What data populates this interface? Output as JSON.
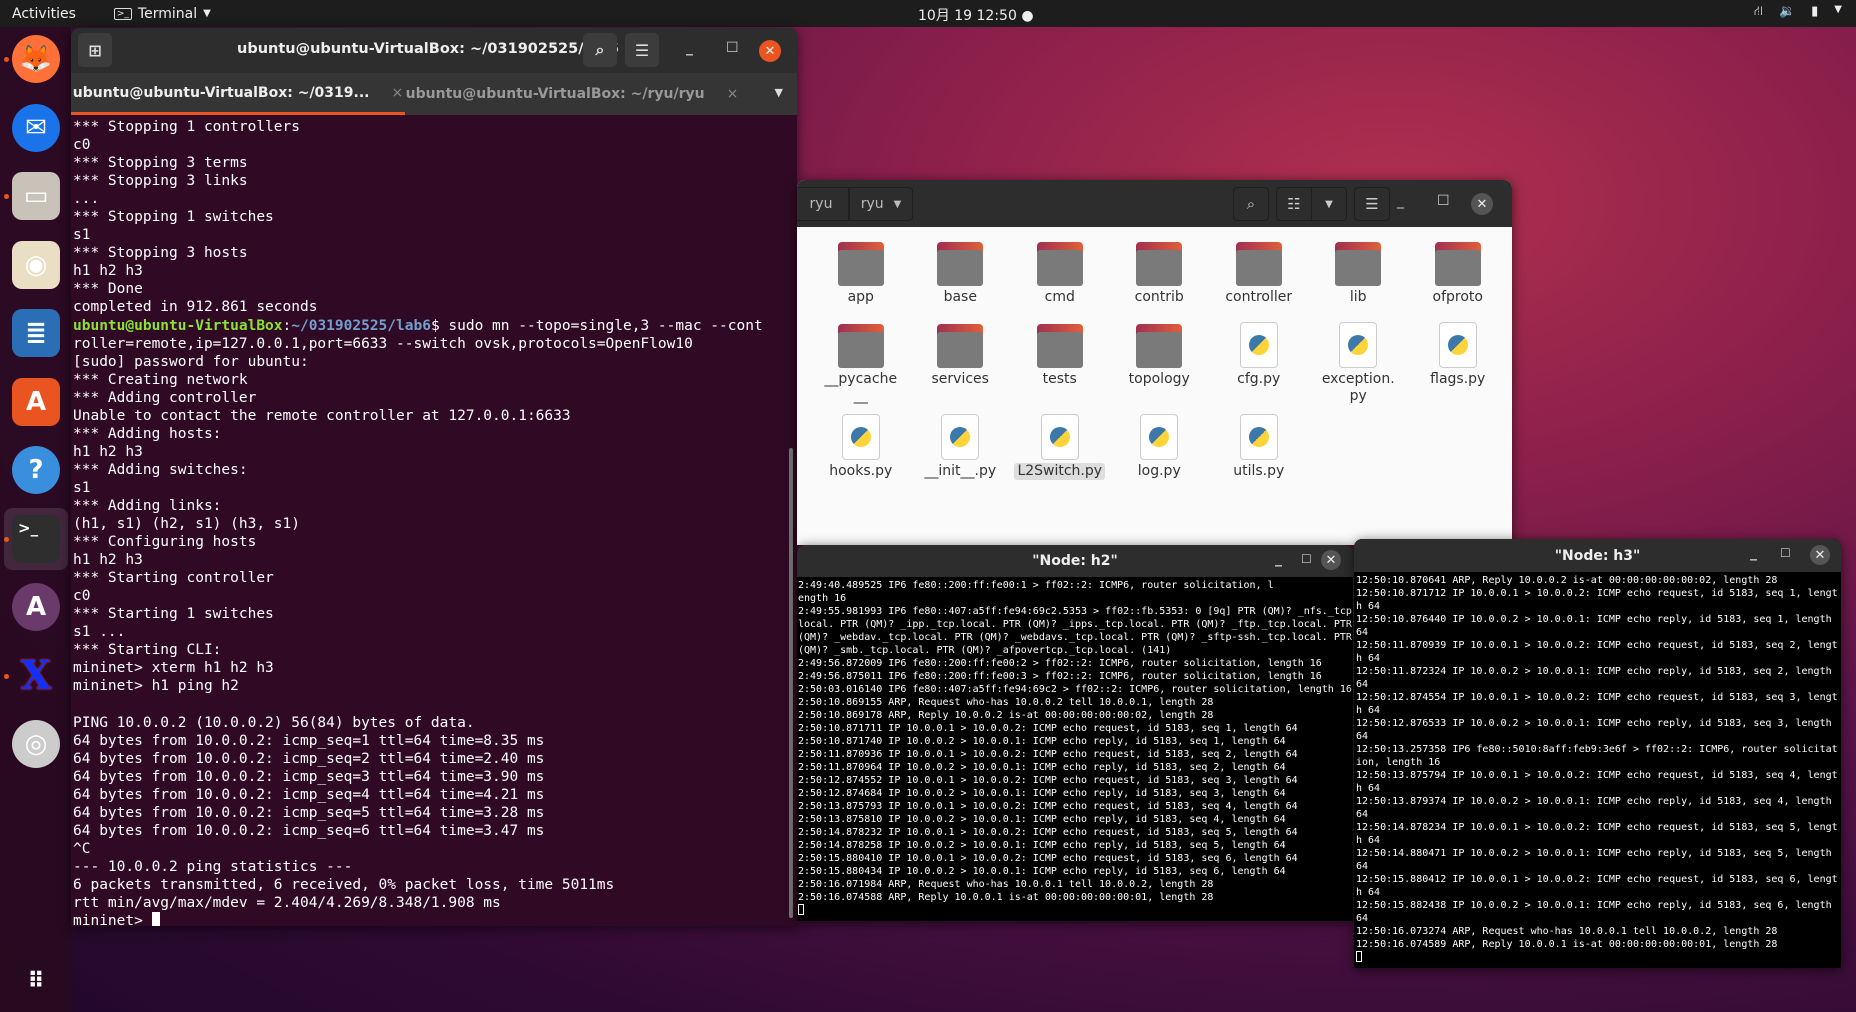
{
  "topbar": {
    "activities": "Activities",
    "app_name": "Terminal",
    "clock": "10月 19  12:50"
  },
  "dock": {
    "items": [
      {
        "name": "firefox",
        "icon": "firefox-icon",
        "running": true
      },
      {
        "name": "thunderbird",
        "icon": "thunderbird-icon",
        "running": false
      },
      {
        "name": "files",
        "icon": "files-icon",
        "running": true
      },
      {
        "name": "rhythmbox",
        "icon": "rhythmbox-icon",
        "running": false
      },
      {
        "name": "libreoffice-writer",
        "icon": "writer-icon",
        "running": false
      },
      {
        "name": "software",
        "icon": "software-icon",
        "running": false
      },
      {
        "name": "help",
        "icon": "help-icon",
        "running": false
      },
      {
        "name": "terminal",
        "icon": "terminal-icon",
        "running": true
      },
      {
        "name": "software-updater",
        "icon": "updater-icon",
        "running": false
      },
      {
        "name": "xterm",
        "icon": "xterm-icon",
        "running": true
      },
      {
        "name": "dvd",
        "icon": "disc-icon",
        "running": false
      }
    ]
  },
  "terminal": {
    "title": "ubuntu@ubuntu-VirtualBox: ~/031902525/lab6",
    "tabs": [
      {
        "label": "ubuntu@ubuntu-VirtualBox: ~/0319...",
        "active": true
      },
      {
        "label": "ubuntu@ubuntu-VirtualBox: ~/ryu/ryu",
        "active": false
      }
    ],
    "tab_close": "×",
    "lines_before": [
      "*** Stopping 1 controllers",
      "c0",
      "*** Stopping 3 terms",
      "*** Stopping 3 links",
      "...",
      "*** Stopping 1 switches",
      "s1",
      "*** Stopping 3 hosts",
      "h1 h2 h3",
      "*** Done",
      "completed in 912.861 seconds"
    ],
    "prompt": {
      "user_host": "ubuntu@ubuntu-VirtualBox",
      "path": "~/031902525/lab6",
      "command": "$ sudo mn --topo=single,3 --mac --cont"
    },
    "lines_after": [
      "roller=remote,ip=127.0.0.1,port=6633 --switch ovsk,protocols=OpenFlow10",
      "[sudo] password for ubuntu:",
      "*** Creating network",
      "*** Adding controller",
      "Unable to contact the remote controller at 127.0.0.1:6633",
      "*** Adding hosts:",
      "h1 h2 h3",
      "*** Adding switches:",
      "s1",
      "*** Adding links:",
      "(h1, s1) (h2, s1) (h3, s1)",
      "*** Configuring hosts",
      "h1 h2 h3",
      "*** Starting controller",
      "c0",
      "*** Starting 1 switches",
      "s1 ...",
      "*** Starting CLI:",
      "mininet> xterm h1 h2 h3",
      "mininet> h1 ping h2",
      "",
      "PING 10.0.0.2 (10.0.0.2) 56(84) bytes of data.",
      "64 bytes from 10.0.0.2: icmp_seq=1 ttl=64 time=8.35 ms",
      "64 bytes from 10.0.0.2: icmp_seq=2 ttl=64 time=2.40 ms",
      "64 bytes from 10.0.0.2: icmp_seq=3 ttl=64 time=3.90 ms",
      "64 bytes from 10.0.0.2: icmp_seq=4 ttl=64 time=4.21 ms",
      "64 bytes from 10.0.0.2: icmp_seq=5 ttl=64 time=3.28 ms",
      "64 bytes from 10.0.0.2: icmp_seq=6 ttl=64 time=3.47 ms",
      "^C",
      "--- 10.0.0.2 ping statistics ---",
      "6 packets transmitted, 6 received, 0% packet loss, time 5011ms",
      "rtt min/avg/max/mdev = 2.404/4.269/8.348/1.908 ms"
    ],
    "final_prompt": "mininet> "
  },
  "file_manager": {
    "breadcrumbs": [
      "ryu",
      "ryu"
    ],
    "files": [
      {
        "name": "app",
        "type": "folder"
      },
      {
        "name": "base",
        "type": "folder"
      },
      {
        "name": "cmd",
        "type": "folder"
      },
      {
        "name": "contrib",
        "type": "folder"
      },
      {
        "name": "controller",
        "type": "folder"
      },
      {
        "name": "lib",
        "type": "folder"
      },
      {
        "name": "ofproto",
        "type": "folder"
      },
      {
        "name": "__pycache__",
        "type": "folder"
      },
      {
        "name": "services",
        "type": "folder"
      },
      {
        "name": "tests",
        "type": "folder"
      },
      {
        "name": "topology",
        "type": "folder"
      },
      {
        "name": "cfg.py",
        "type": "python"
      },
      {
        "name": "exception.py",
        "type": "python"
      },
      {
        "name": "flags.py",
        "type": "python"
      },
      {
        "name": "hooks.py",
        "type": "python"
      },
      {
        "name": "__init__.py",
        "type": "python"
      },
      {
        "name": "L2Switch.py",
        "type": "python",
        "selected": true
      },
      {
        "name": "log.py",
        "type": "python"
      },
      {
        "name": "utils.py",
        "type": "python"
      }
    ]
  },
  "xterm_h2": {
    "title": "\"Node: h2\"",
    "lines": [
      "2:49:40.489525 IP6 fe80::200:ff:fe00:1 > ff02::2: ICMP6, router solicitation, l",
      "ength 16",
      "2:49:55.981993 IP6 fe80::407:a5ff:fe94:69c2.5353 > ff02::fb.5353: 0 [9q] PTR (QM)? _nfs._tcp",
      "local. PTR (QM)? _ipp._tcp.local. PTR (QM)? _ipps._tcp.local. PTR (QM)? _ftp._tcp.local. PTR",
      "(QM)? _webdav._tcp.local. PTR (QM)? _webdavs._tcp.local. PTR (QM)? _sftp-ssh._tcp.local. PTR",
      "(QM)? _smb._tcp.local. PTR (QM)? _afpovertcp._tcp.local. (141)",
      "2:49:56.872009 IP6 fe80::200:ff:fe00:2 > ff02::2: ICMP6, router solicitation, length 16",
      "2:49:56.875011 IP6 fe80::200:ff:fe00:3 > ff02::2: ICMP6, router solicitation, length 16",
      "2:50:03.016140 IP6 fe80::407:a5ff:fe94:69c2 > ff02::2: ICMP6, router solicitation, length 16",
      "2:50:10.869155 ARP, Request who-has 10.0.0.2 tell 10.0.0.1, length 28",
      "2:50:10.869178 ARP, Reply 10.0.0.2 is-at 00:00:00:00:00:02, length 28",
      "2:50:10.871711 IP 10.0.0.1 > 10.0.0.2: ICMP echo request, id 5183, seq 1, length 64",
      "2:50:10.871740 IP 10.0.0.2 > 10.0.0.1: ICMP echo reply, id 5183, seq 1, length 64",
      "2:50:11.870936 IP 10.0.0.1 > 10.0.0.2: ICMP echo request, id 5183, seq 2, length 64",
      "2:50:11.870964 IP 10.0.0.2 > 10.0.0.1: ICMP echo reply, id 5183, seq 2, length 64",
      "2:50:12.874552 IP 10.0.0.1 > 10.0.0.2: ICMP echo request, id 5183, seq 3, length 64",
      "2:50:12.874684 IP 10.0.0.2 > 10.0.0.1: ICMP echo reply, id 5183, seq 3, length 64",
      "2:50:13.875793 IP 10.0.0.1 > 10.0.0.2: ICMP echo request, id 5183, seq 4, length 64",
      "2:50:13.875810 IP 10.0.0.2 > 10.0.0.1: ICMP echo reply, id 5183, seq 4, length 64",
      "2:50:14.878232 IP 10.0.0.1 > 10.0.0.2: ICMP echo request, id 5183, seq 5, length 64",
      "2:50:14.878258 IP 10.0.0.2 > 10.0.0.1: ICMP echo reply, id 5183, seq 5, length 64",
      "2:50:15.880410 IP 10.0.0.1 > 10.0.0.2: ICMP echo request, id 5183, seq 6, length 64",
      "2:50:15.880434 IP 10.0.0.2 > 10.0.0.1: ICMP echo reply, id 5183, seq 6, length 64",
      "2:50:16.071984 ARP, Request who-has 10.0.0.1 tell 10.0.0.2, length 28",
      "2:50:16.074588 ARP, Reply 10.0.0.1 is-at 00:00:00:00:00:01, length 28"
    ]
  },
  "xterm_h3": {
    "title": "\"Node: h3\"",
    "lines": [
      "12:50:10.870641 ARP, Reply 10.0.0.2 is-at 00:00:00:00:00:02, length 28",
      "12:50:10.871712 IP 10.0.0.1 > 10.0.0.2: ICMP echo request, id 5183, seq 1, lengt",
      "h 64",
      "12:50:10.876440 IP 10.0.0.2 > 10.0.0.1: ICMP echo reply, id 5183, seq 1, length",
      "64",
      "12:50:11.870939 IP 10.0.0.1 > 10.0.0.2: ICMP echo request, id 5183, seq 2, lengt",
      "h 64",
      "12:50:11.872324 IP 10.0.0.2 > 10.0.0.1: ICMP echo reply, id 5183, seq 2, length",
      "64",
      "12:50:12.874554 IP 10.0.0.1 > 10.0.0.2: ICMP echo request, id 5183, seq 3, lengt",
      "h 64",
      "12:50:12.876533 IP 10.0.0.2 > 10.0.0.1: ICMP echo reply, id 5183, seq 3, length",
      "64",
      "12:50:13.257358 IP6 fe80::5010:8aff:feb9:3e6f > ff02::2: ICMP6, router solicitat",
      "ion, length 16",
      "12:50:13.875794 IP 10.0.0.1 > 10.0.0.2: ICMP echo request, id 5183, seq 4, lengt",
      "h 64",
      "12:50:13.879374 IP 10.0.0.2 > 10.0.0.1: ICMP echo reply, id 5183, seq 4, length",
      "64",
      "12:50:14.878234 IP 10.0.0.1 > 10.0.0.2: ICMP echo request, id 5183, seq 5, lengt",
      "h 64",
      "12:50:14.880471 IP 10.0.0.2 > 10.0.0.1: ICMP echo reply, id 5183, seq 5, length",
      "64",
      "12:50:15.880412 IP 10.0.0.1 > 10.0.0.2: ICMP echo request, id 5183, seq 6, lengt",
      "h 64",
      "12:50:15.882438 IP 10.0.0.2 > 10.0.0.1: ICMP echo reply, id 5183, seq 6, length",
      "64",
      "12:50:16.073274 ARP, Request who-has 10.0.0.1 tell 10.0.0.2, length 28",
      "12:50:16.074589 ARP, Reply 10.0.0.1 is-at 00:00:00:00:00:01, length 28"
    ]
  },
  "colors": {
    "accent": "#e95420",
    "terminal_bg": "#300a24",
    "prompt_green": "#8ae234",
    "prompt_blue": "#729fcf"
  }
}
